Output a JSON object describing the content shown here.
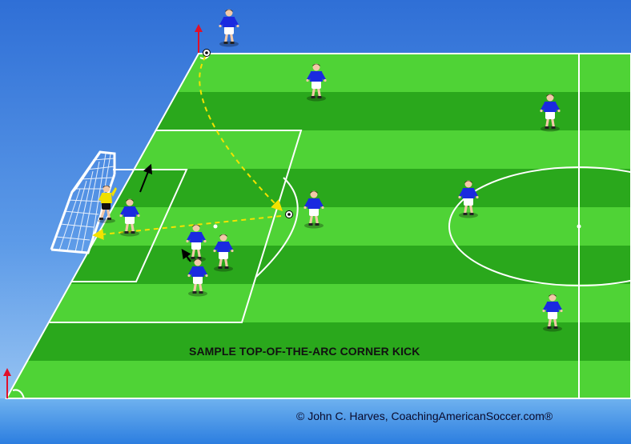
{
  "diagram": {
    "caption": "SAMPLE TOP-OF-THE-ARC CORNER KICK",
    "credit": "© John C. Harves, CoachingAmericanSoccer.com®"
  },
  "colors": {
    "sky_top": "#2f6fd6",
    "sky_bottom": "#9cc8f4",
    "grass_light": "#4fd336",
    "grass_dark": "#2aa81c",
    "lines": "#ffffff",
    "ball_path": "#f4e200",
    "run_arrow": "#000000",
    "flag_arrow": "#e0102a",
    "attacker_shirt": "#1a2ae0",
    "keeper_shirt": "#f0e000"
  },
  "icons": [
    "soccer-goal-icon",
    "soccer-ball-icon",
    "player-icon",
    "goalkeeper-icon",
    "corner-flag-icon",
    "arrow-icon"
  ]
}
